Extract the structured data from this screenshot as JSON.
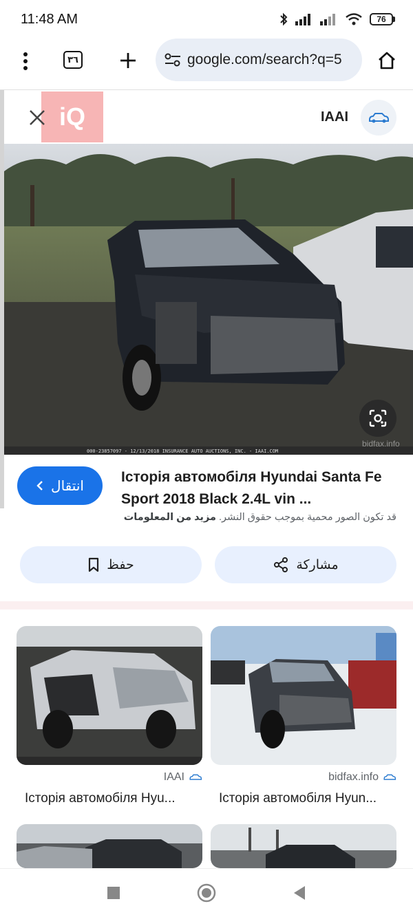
{
  "status": {
    "time": "11:48 AM",
    "battery": "76"
  },
  "toolbar": {
    "tab_count": "٣٦",
    "url": "google.com/search?q=5"
  },
  "viewer": {
    "source_name": "IAAI",
    "watermark": "iQ",
    "image_caption": "000-23857097 - 12/13/2018 INSURANCE AUTO AUCTIONS, INC. - IAAI.COM",
    "image_watermark": "bidfax.info",
    "visit_label": "انتقال",
    "title": "Історія автомобіля Hyundai Santa Fe Sport 2018 Black 2.4L vin ...",
    "copyright_note": "قد تكون الصور محمية بموجب حقوق النشر.",
    "more_info": "مزيد من المعلومات",
    "share_label": "مشاركة",
    "save_label": "حفظ"
  },
  "related": [
    {
      "source": "IAAI",
      "title": "Історія автомобіля Hyu..."
    },
    {
      "source": "bidfax.info",
      "title": "Історія автомобіля Hyun..."
    }
  ],
  "colors": {
    "accent": "#1a73e8",
    "tonal": "#e8f0fe",
    "omnibox": "#e9eef6"
  },
  "icons": {
    "menu": "more-vert-icon",
    "new_tab": "plus-icon",
    "site_settings": "tune-icon",
    "home": "home-icon",
    "close": "close-icon",
    "lens": "lens-icon",
    "share": "share-icon",
    "save": "bookmark-icon",
    "source_logo": "car-icon"
  }
}
